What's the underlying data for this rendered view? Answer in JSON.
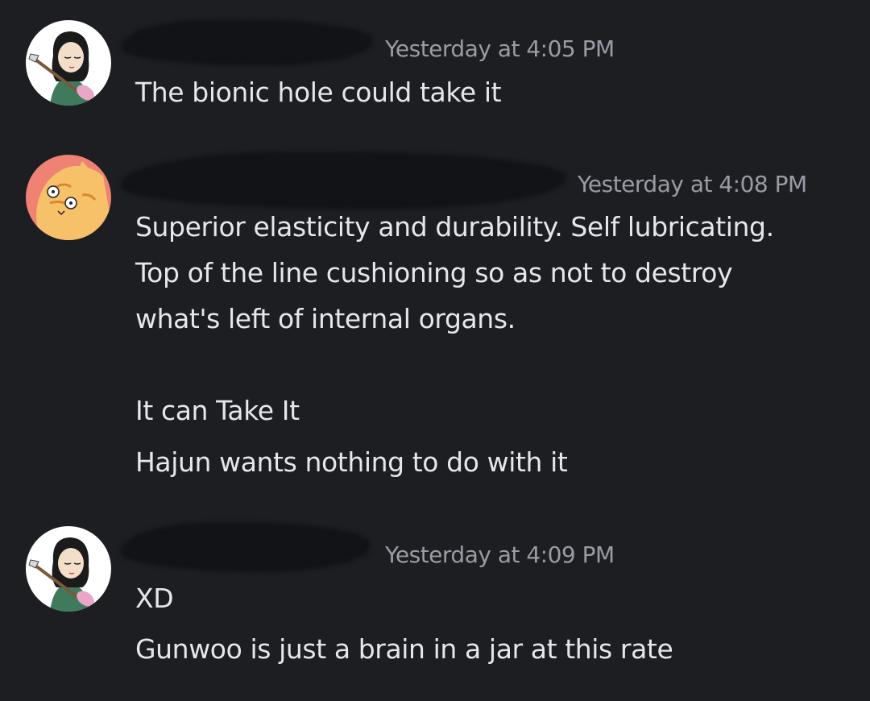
{
  "messages": [
    {
      "avatar": "girl-with-guitar-avatar",
      "timestamp": "Yesterday at 4:05 PM",
      "lines": [
        "The bionic hole could take it"
      ]
    },
    {
      "avatar": "orange-cat-avatar",
      "timestamp": "Yesterday at 4:08 PM",
      "lines": [
        "Superior elasticity and durability. Self lubricating.",
        "Top of the line cushioning so as not to destroy",
        "what's left of internal organs.",
        "It can Take It",
        "Hajun wants nothing to do with it"
      ]
    },
    {
      "avatar": "girl-with-guitar-avatar",
      "timestamp": "Yesterday at 4:09 PM",
      "lines": [
        "XD",
        "Gunwoo is just a brain in a jar at this rate"
      ]
    }
  ],
  "colors": {
    "background": "#1d1e22",
    "text": "#e6e7ea",
    "timestamp": "#9a9ca5"
  }
}
